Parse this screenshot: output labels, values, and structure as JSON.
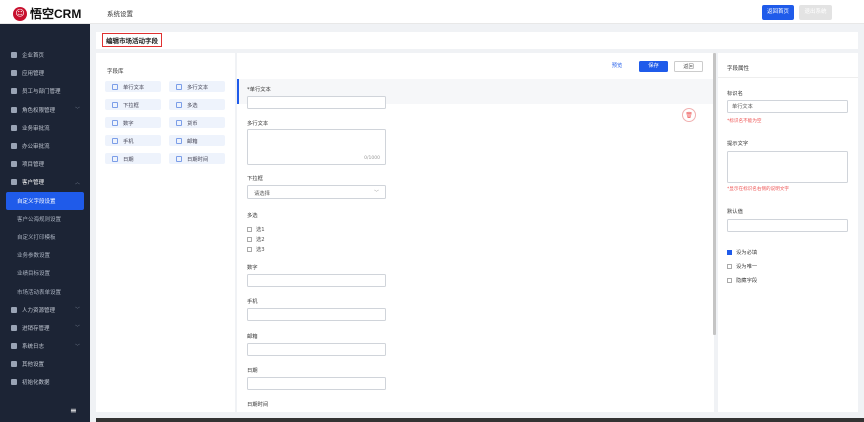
{
  "app": {
    "logo_text": "悟空CRM",
    "top_title": "系统设置",
    "home_button": "返回首页",
    "logout_button": "退出系统"
  },
  "sidebar": {
    "items": [
      {
        "label": "企业首页",
        "icon": "home-icon",
        "chev": ""
      },
      {
        "label": "应用管理",
        "icon": "grid-icon",
        "chev": ""
      },
      {
        "label": "员工与部门管理",
        "icon": "users-icon",
        "chev": ""
      },
      {
        "label": "角色权限管理",
        "icon": "role-icon",
        "chev": "﹀"
      },
      {
        "label": "业务审批流",
        "icon": "approval-icon",
        "chev": ""
      },
      {
        "label": "办公审批流",
        "icon": "office-icon",
        "chev": ""
      },
      {
        "label": "项目管理",
        "icon": "project-icon",
        "chev": ""
      },
      {
        "label": "客户管理",
        "icon": "customer-icon",
        "chev": "︿"
      },
      {
        "label": "自定义字段设置",
        "sub": true,
        "active": true
      },
      {
        "label": "客户公海规则设置",
        "sub": true
      },
      {
        "label": "自定义打印模板",
        "sub": true
      },
      {
        "label": "业务参数设置",
        "sub": true
      },
      {
        "label": "业绩目标设置",
        "sub": true
      },
      {
        "label": "市场活动表单设置",
        "sub": true
      },
      {
        "label": "人力资源管理",
        "icon": "hr-icon",
        "chev": "﹀"
      },
      {
        "label": "进销存管理",
        "icon": "stock-icon",
        "chev": "﹀"
      },
      {
        "label": "系统日志",
        "icon": "log-icon",
        "chev": "﹀"
      },
      {
        "label": "其他设置",
        "icon": "settings-icon",
        "chev": ""
      },
      {
        "label": "初始化数据",
        "icon": "init-icon",
        "chev": ""
      }
    ],
    "collapse_icon": "menu-fold-icon"
  },
  "page": {
    "title": "编辑市场活动字段"
  },
  "library": {
    "title": "字段库",
    "fields": [
      "单行文本",
      "多行文本",
      "下拉框",
      "多选",
      "数字",
      "货币",
      "手机",
      "邮箱",
      "日期",
      "日期时间"
    ]
  },
  "canvas": {
    "preview": "预览",
    "save": "保存",
    "back": "返回",
    "single_label": "*单行文本",
    "multi_label": "多行文本",
    "multi_count": "0/1000",
    "select_label": "下拉框",
    "select_placeholder": "请选择",
    "checkbox_label": "多选",
    "options": [
      "选1",
      "选2",
      "选3"
    ],
    "number_label": "数字",
    "phone_label": "手机",
    "email_label": "邮箱",
    "date_label": "日期",
    "datetime_label": "日期时间"
  },
  "props": {
    "title": "字段属性",
    "name_label": "标识名",
    "name_value": "单行文本",
    "name_hint": "*标识名不能为空",
    "tip_label": "提示文字",
    "tip_hint": "*显示在标识名右侧的说明文字",
    "default_label": "默认值",
    "required": "设为必填",
    "unique": "设为唯一",
    "hidden": "隐藏字段"
  },
  "colors": {
    "primary": "#1f5bea",
    "sidebar": "#1c2435",
    "danger": "#e03131"
  }
}
